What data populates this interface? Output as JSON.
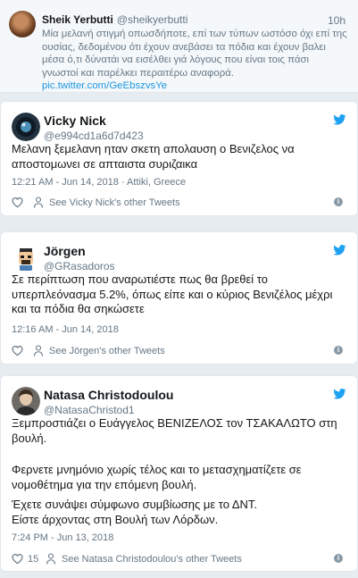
{
  "top_reply": {
    "name": "Sheik Yerbutti",
    "handle": "@sheikyerbutti",
    "time": "10h",
    "text": "Μία μελανή στιγμή οπωσδήποτε, επί των τύπων ωστόσο όχι επί της ουσίας, δεδομένου ότι έχουν ανεβάσει τα πόδια και έχουν βαλει μέσα ό,τι δύνατάι να εισέλθει γιά λόγους που είναι τοις πάσι γνωστοί και παρέλκει περαιτέρω αναφορά.",
    "link": "pic.twitter.com/GeEbszvsYe"
  },
  "tweets": [
    {
      "name": "Vicky Nick",
      "handle": "@e994cd1a6d7d423",
      "text": "Μελανη ξεμελανη ηταν σκετη απολαυση ο Βενιζελος να αποστομωνει σε απταιστα συριζαικα",
      "meta": "12:21 AM - Jun 14, 2018",
      "location": "Attiki, Greece",
      "likes": "",
      "see_other": "See Vicky Nick's other Tweets"
    },
    {
      "name": "Jörgen",
      "handle": "@GRasadoros",
      "text": "Σε περίπτωση που αναρωτιέστε πως θα βρεθεί το υπερπλεόνασμα 5.2%, όπως είπε και ο κύριος Βενιζέλος μέχρι και τα πόδια θα σηκώσετε",
      "meta": "12:16 AM - Jun 14, 2018",
      "location": "",
      "likes": "",
      "see_other": "See Jörgen's other Tweets"
    },
    {
      "name": "Natasa Christodoulou",
      "handle": "@NatasaChristod1",
      "text_p1": "Ξεμπροστιάζει ο Ευάγγελος ΒΕΝΙΖΕΛΟΣ τον ΤΣΑΚΑΛΩΤΟ στη βουλή.",
      "text_p2": "Φερνετε μνημόνιο χωρίς τέλος και το μετασχηματίζετε σε νομοθέτημα για την επόμενη βουλή.",
      "text_p3": "Έχετε συνάψει σύμφωνο συμβίωσης με το ΔΝΤ.",
      "text_p4": "Είστε άρχοντας στη Βουλή των Λόρδων.",
      "meta": "7:24 PM - Jun 13, 2018",
      "location": "",
      "likes": "15",
      "see_other": "See Natasa Christodoulou's other Tweets"
    }
  ],
  "icons": {
    "bird": "twitter-bird-icon",
    "heart": "heart-icon",
    "person": "person-icon",
    "info": "info-icon"
  },
  "colors": {
    "accent": "#1da1f2",
    "link": "#1b95e0",
    "muted": "#657786",
    "background": "#e6ecf0"
  },
  "info_glyph": "i"
}
